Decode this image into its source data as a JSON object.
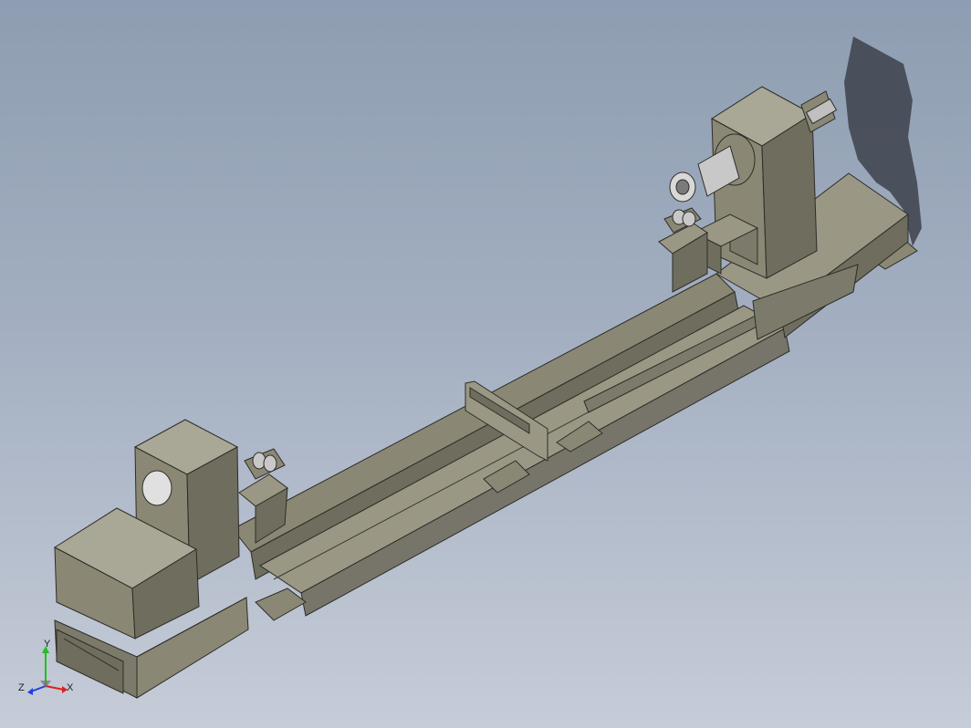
{
  "viewport": {
    "background_top": "#8e9db1",
    "background_bottom": "#c6ccd8"
  },
  "model": {
    "steel_color": "#8a8874",
    "shadow_color": "#3a3f48",
    "chrome_color": "#c8c8c8"
  },
  "triad": {
    "x_label": "X",
    "y_label": "Y",
    "z_label": "Z",
    "x_color": "#e02020",
    "y_color": "#20c020",
    "z_color": "#2040e0"
  }
}
